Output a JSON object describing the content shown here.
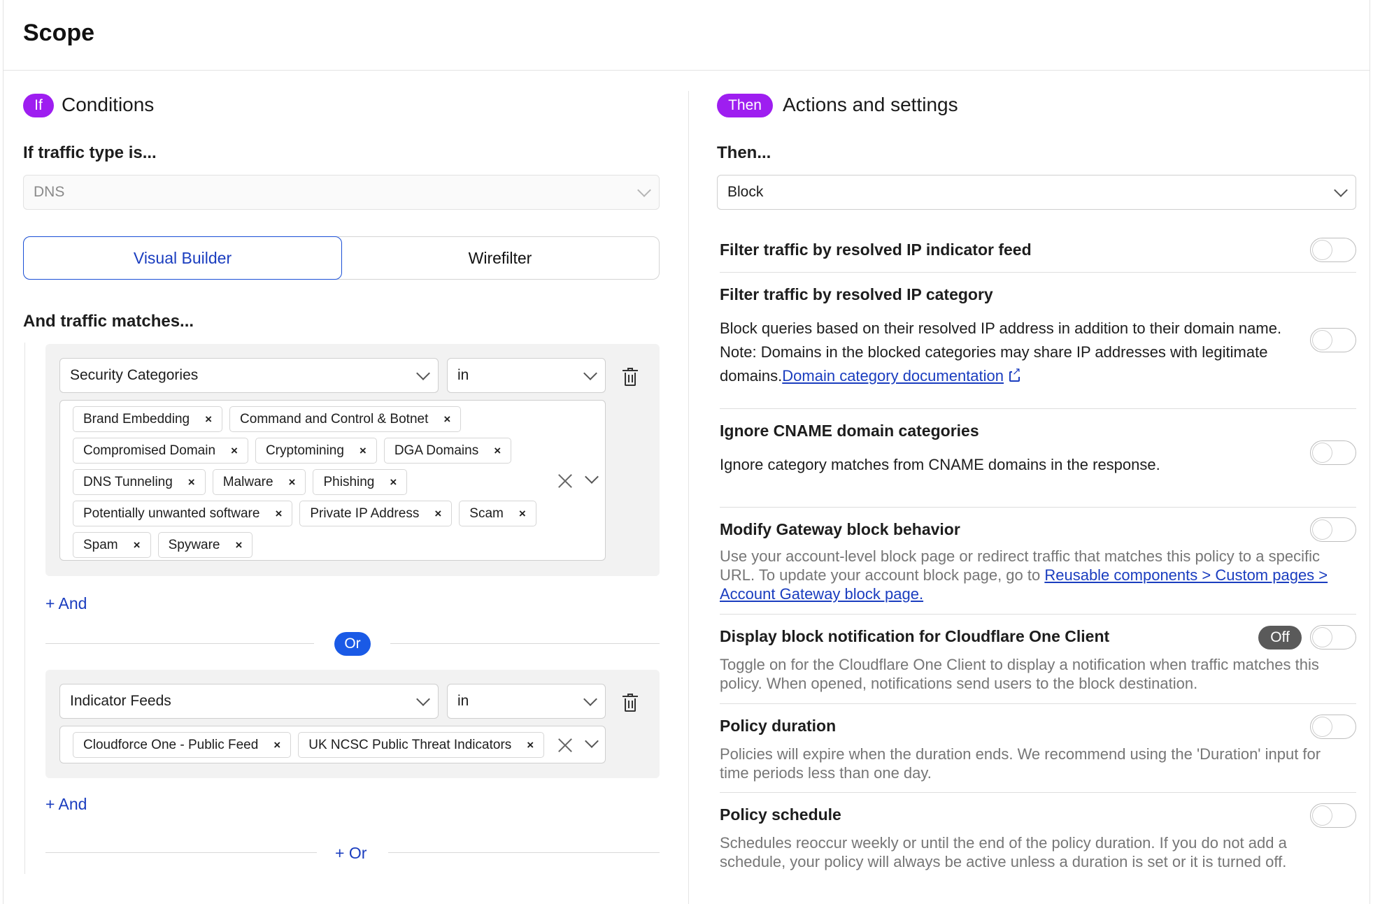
{
  "page": {
    "title": "Scope"
  },
  "conditions": {
    "badge": "If",
    "heading": "Conditions",
    "traffic_type_label": "If traffic type is...",
    "traffic_type_value": "DNS",
    "builder_tabs": [
      "Visual Builder",
      "Wirefilter"
    ],
    "active_tab": "Visual Builder",
    "matches_label": "And traffic matches...",
    "groups": [
      {
        "selector": "Security Categories",
        "operator": "in",
        "values": [
          "Brand Embedding",
          "Command and Control & Botnet",
          "Compromised Domain",
          "Cryptomining",
          "DGA Domains",
          "DNS Tunneling",
          "Malware",
          "Phishing",
          "Potentially unwanted software",
          "Private IP Address",
          "Scam",
          "Spam",
          "Spyware"
        ],
        "and_label": "+ And"
      },
      {
        "selector": "Indicator Feeds",
        "operator": "in",
        "values": [
          "Cloudforce One - Public Feed",
          "UK NCSC Public Threat Indicators"
        ],
        "and_label": "+ And"
      }
    ],
    "or_badge": "Or",
    "add_or_label": "+ Or",
    "tag_remove_glyph": "×"
  },
  "actions": {
    "badge": "Then",
    "heading": "Actions and settings",
    "then_label": "Then...",
    "action_value": "Block",
    "settings": {
      "ip_feed": {
        "title": "Filter traffic by resolved IP indicator feed"
      },
      "ip_category": {
        "title": "Filter traffic by resolved IP category",
        "desc": "Block queries based on their resolved IP address in addition to their domain name. Note: Domains in the blocked categories may share IP addresses with legitimate domains.",
        "link": "Domain category documentation"
      },
      "cname": {
        "title": "Ignore CNAME domain categories",
        "desc": "Ignore category matches from CNAME domains in the response."
      },
      "block_behavior": {
        "title": "Modify Gateway block behavior",
        "desc": "Use your account-level block page or redirect traffic that matches this policy to a specific URL. To update your account block page, go to ",
        "link": "Reusable components > Custom pages > Account Gateway block page."
      },
      "notification": {
        "title": "Display block notification for Cloudflare One Client",
        "badge": "Off",
        "desc": "Toggle on for the Cloudflare One Client to display a notification when traffic matches this policy. When opened, notifications send users to the block destination."
      },
      "duration": {
        "title": "Policy duration",
        "desc": "Policies will expire when the duration ends. We recommend using the 'Duration' input for time periods less than one day."
      },
      "schedule": {
        "title": "Policy schedule",
        "desc": "Schedules reoccur weekly or until the end of the policy duration. If you do not add a schedule, your policy will always be active unless a duration is set or it is turned off."
      }
    }
  },
  "colors": {
    "badge_purple": "#9e1ef0",
    "or_blue": "#1a5ae6",
    "link_blue": "#1a3dbf"
  }
}
